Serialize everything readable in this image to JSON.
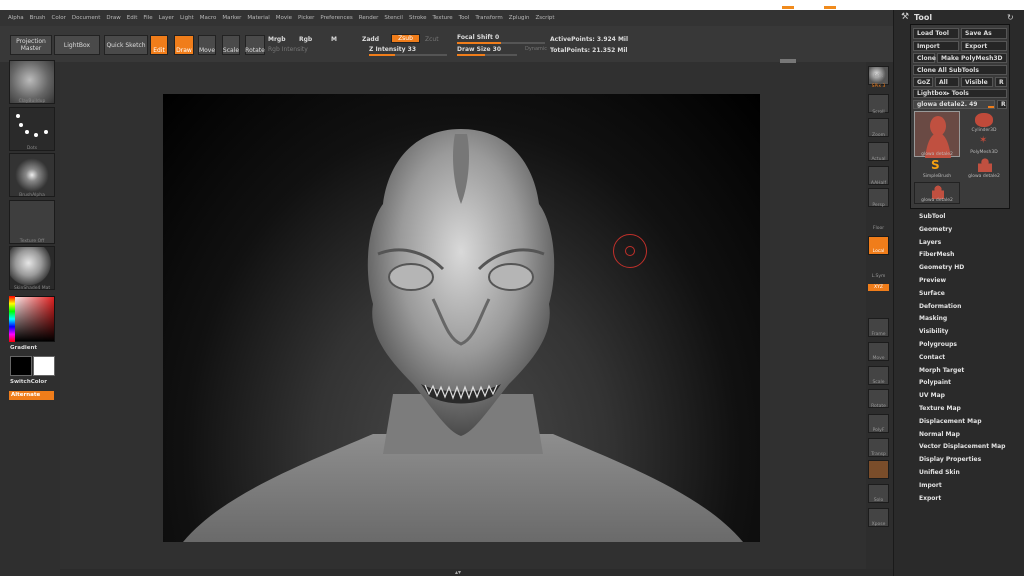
{
  "menu": [
    "Alpha",
    "Brush",
    "Color",
    "Document",
    "Draw",
    "Edit",
    "File",
    "Layer",
    "Light",
    "Macro",
    "Marker",
    "Material",
    "Movie",
    "Picker",
    "Preferences",
    "Render",
    "Stencil",
    "Stroke",
    "Texture",
    "Tool",
    "Transform",
    "Zplugin",
    "Zscript"
  ],
  "shelf": {
    "projection_master": "Projection Master",
    "lightbox": "LightBox",
    "quick_sketch": "Quick Sketch",
    "edit": "Edit",
    "draw": "Draw",
    "move": "Move",
    "scale": "Scale",
    "rotate": "Rotate",
    "mrgb": "Mrgb",
    "rgb": "Rgb",
    "m": "M",
    "rgb_intensity": "Rgb Intensity",
    "zadd": "Zadd",
    "zsub": "Zsub",
    "zcut": "Zcut",
    "z_intensity": "Z Intensity 33",
    "focal_shift": "Focal Shift 0",
    "draw_size": "Draw Size 30",
    "dynamic": "Dynamic",
    "active_points": "ActivePoints: 3.924 Mil",
    "total_points": "TotalPoints: 21.352 Mil",
    "z_intensity_value": 33,
    "draw_size_value": 30,
    "focal_shift_value": 0
  },
  "left": {
    "brush_label": "ClayBuildup",
    "stroke_label": "Dots",
    "alpha_label": "BrushAlpha",
    "texture_label": "Texture Off",
    "material_label": "SkinShade4 Mat",
    "gradient": "Gradient",
    "switchcolor": "SwitchColor",
    "alternate": "Alternate"
  },
  "right_icons": [
    {
      "name": "bpr-button",
      "label": "BPR"
    },
    {
      "name": "spix-label",
      "label": "SPix 3"
    },
    {
      "name": "scroll-button",
      "label": "Scroll"
    },
    {
      "name": "zoom-button",
      "label": "Zoom"
    },
    {
      "name": "actual-button",
      "label": "Actual"
    },
    {
      "name": "aahalf-button",
      "label": "AAHalf"
    },
    {
      "name": "persp-button",
      "label": "Persp"
    },
    {
      "name": "floor-button",
      "label": "Floor"
    },
    {
      "name": "local-button",
      "label": "Local"
    },
    {
      "name": "lsym-button",
      "label": "L.Sym"
    },
    {
      "name": "xyz-button",
      "label": "XYZ"
    },
    {
      "name": "frame-button",
      "label": "Frame"
    },
    {
      "name": "move-view-button",
      "label": "Move"
    },
    {
      "name": "scale-view-button",
      "label": "Scale"
    },
    {
      "name": "rotate-view-button",
      "label": "Rotate"
    },
    {
      "name": "polyf-button",
      "label": "PolyF"
    },
    {
      "name": "transp-button",
      "label": "Transp"
    },
    {
      "name": "solo-button",
      "label": "Solo"
    },
    {
      "name": "xpose-button",
      "label": "Xpose"
    }
  ],
  "tool": {
    "title": "Tool",
    "load_tool": "Load Tool",
    "save_as": "Save As",
    "import": "Import",
    "export": "Export",
    "clone": "Clone",
    "make_polymesh": "Make PolyMesh3D",
    "clone_all": "Clone All SubTools",
    "goz": "GoZ",
    "all": "All",
    "visible": "Visible",
    "r": "R",
    "lightbox_tools": "Lightbox▸ Tools",
    "current_tool": "glowa detale2. 49",
    "thumbs": [
      {
        "label": "glowa detale2"
      },
      {
        "label": "Cylinder3D"
      },
      {
        "label": "PolyMesh3D"
      },
      {
        "label": "SimpleBrush"
      },
      {
        "label": "glowa detale2"
      },
      {
        "label": "glowa detale2"
      }
    ]
  },
  "subpalettes": [
    "SubTool",
    "Geometry",
    "Layers",
    "FiberMesh",
    "Geometry HD",
    "Preview",
    "Surface",
    "Deformation",
    "Masking",
    "Visibility",
    "Polygroups",
    "Contact",
    "Morph Target",
    "Polypaint",
    "UV Map",
    "Texture Map",
    "Displacement Map",
    "Normal Map",
    "Vector Displacement Map",
    "Display Properties",
    "Unified Skin",
    "Import",
    "Export"
  ],
  "colors": {
    "accent": "#f07d1a",
    "panel": "#2a2a2a"
  }
}
